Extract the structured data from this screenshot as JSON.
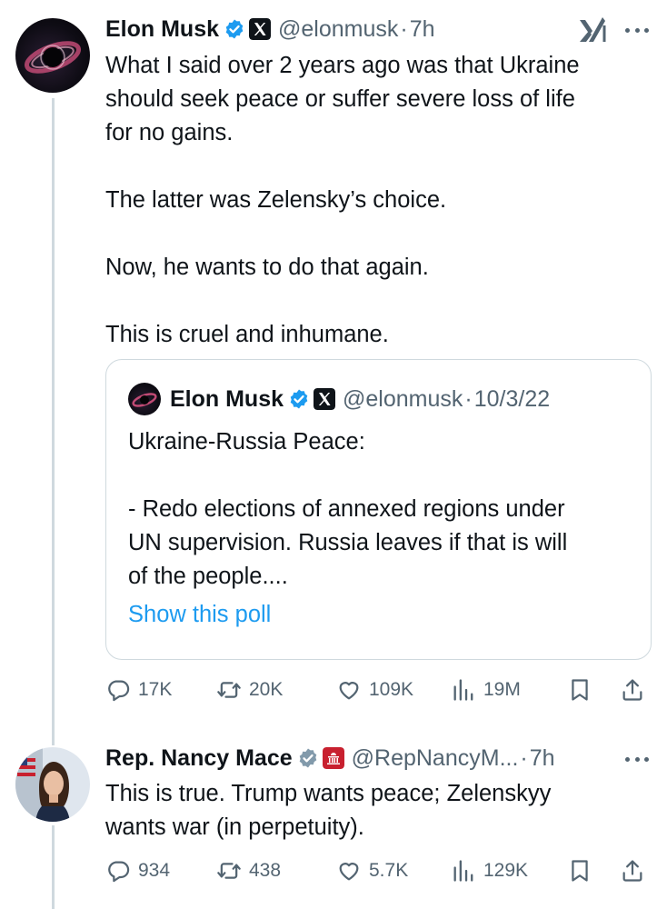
{
  "main_tweet": {
    "author_name": "Elon Musk",
    "handle": "@elonmusk",
    "dot": "·",
    "time": "7h",
    "text": "What I said over 2 years ago was that Ukraine\nshould seek peace or suffer severe loss of life\nfor no gains.\n\nThe latter was Zelensky’s choice.\n\nNow, he wants to do that again.\n\nThis is cruel and inhumane.",
    "avatar_icon": "galaxy-avatar",
    "affiliate_icon": "xai-logo-icon",
    "quoted": {
      "author_name": "Elon Musk",
      "handle": "@elonmusk",
      "dot": "·",
      "date": "10/3/22",
      "text": "Ukraine-Russia Peace:\n\n- Redo elections of annexed regions under\nUN supervision. Russia leaves if that is will\nof the people....",
      "poll_link": "Show this poll"
    },
    "stats": {
      "replies": "17K",
      "reposts": "20K",
      "likes": "109K",
      "views": "19M"
    }
  },
  "reply_tweet": {
    "author_name": "Rep. Nancy Mace",
    "handle": "@RepNancyM...",
    "dot": "·",
    "time": "7h",
    "text": "This is true. Trump wants peace; Zelenskyy\nwants war (in perpetuity).",
    "stats": {
      "replies": "934",
      "reposts": "438",
      "likes": "5.7K",
      "views": "129K"
    }
  },
  "colors": {
    "text": "#0f1419",
    "secondary": "#536471",
    "link": "#1d9bf0",
    "verified_blue": "#1d9bf0",
    "verified_gray": "#829aab",
    "border": "#cfd9de"
  }
}
